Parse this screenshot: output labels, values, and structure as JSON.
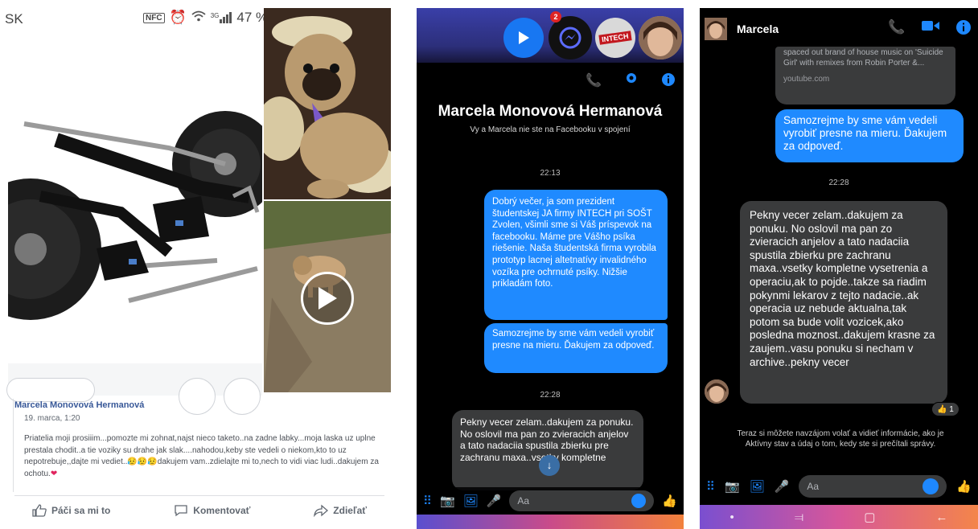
{
  "fb": {
    "status": {
      "carrier": "SK",
      "nfc": "NFC",
      "network": "3G",
      "battery": "47 %"
    },
    "post": {
      "author": "Marcela Monovová Hermanová",
      "date": "19. marca, 1:20",
      "text": "Priatelia moji prosiiim...pomozte mi zohnat,najst nieco taketo..na zadne labky...moja laska uz uplne prestala chodit..a tie voziky su drahe jak slak....nahodou,keby ste vedeli o niekom,kto to uz nepotrebuje,,dajte mi vediet..",
      "text_tail": "dakujem vam..zdielajte mi to,nech to vidi viac ludi..dakujem za ochotu."
    },
    "actions": {
      "like": "Páči sa mi to",
      "comment": "Komentovať",
      "share": "Zdieľať"
    }
  },
  "chat1": {
    "story_badge": "2",
    "intech_logo": "INTECH",
    "name": "Marcela Monovová Hermanová",
    "subtitle": "Vy a Marcela nie ste na Facebooku v spojení",
    "time1": "22:13",
    "msg_out_1": "Dobrý večer, ja som prezident študentskej JA firmy INTECH pri SOŠT Zvolen, všimli sme si Váš príspevok na facebooku. Máme pre Vášho psíka riešenie. Naša študentská firma vyrobila prototyp lacnej altetnatívy invalidného vozíka pre ochrnuté psíky. Nižšie prikladám foto.",
    "msg_out_2": "Samozrejme by sme vám vedeli vyrobiť presne na mieru. Ďakujem za odpoveď.",
    "time2": "22:28",
    "msg_in": "Pekny vecer zelam..dakujem za ponuku. No oslovil ma pan zo zvieracich anjelov a tato nadaciia spustila zbierku pre zachranu maxa..vsetky kompletne",
    "composer_placeholder": "Aa"
  },
  "chat2": {
    "name": "Marcela",
    "link_text": "spaced out brand of house music on 'Suicide Girl' with remixes from Robin Porter &...",
    "link_domain": "youtube.com",
    "msg_out": "Samozrejme by sme vám vedeli vyrobiť presne na mieru. Ďakujem za odpoveď.",
    "time": "22:28",
    "msg_in": "Pekny vecer zelam..dakujem za ponuku. No oslovil ma pan zo zvieracich anjelov a tato nadaciia spustila zbierku pre zachranu maxa..vsetky kompletne vysetrenia a operaciu,ak to pojde..takze sa riadim pokynmi lekarov z tejto nadacie..ak operacia uz nebude aktualna,tak potom sa bude volit vozicek,ako posledna moznost..dakujem krasne za zaujem..vasu ponuku si necham v archive..pekny vecer",
    "reaction_count": "1",
    "info": "Teraz si môžete navzájom volať a vidieť informácie, ako je Aktívny stav a údaj o tom, kedy ste si prečítali správy.",
    "composer_placeholder": "Aa"
  }
}
